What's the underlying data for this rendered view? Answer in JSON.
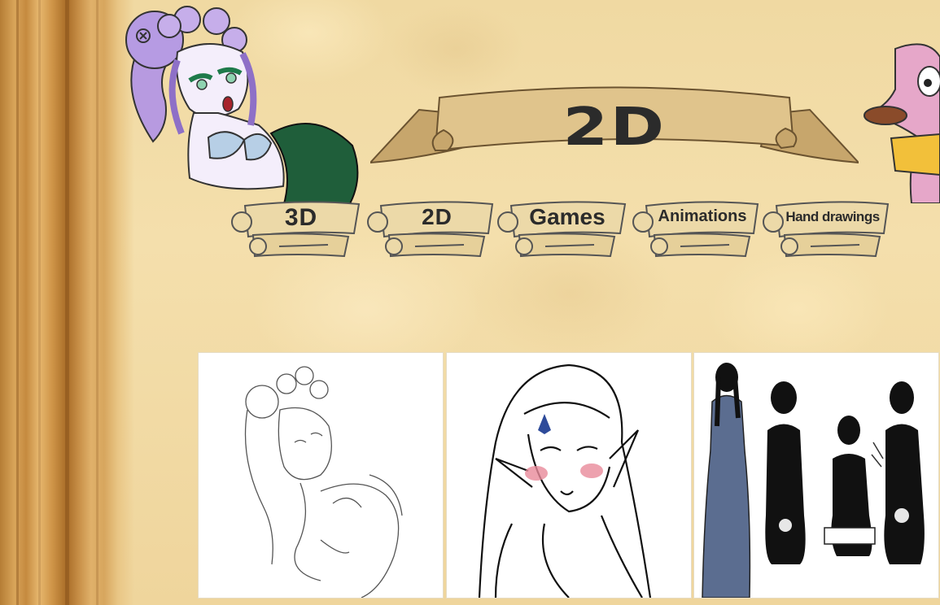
{
  "header": {
    "title": "2D"
  },
  "nav": {
    "items": [
      {
        "label": "3D"
      },
      {
        "label": "2D"
      },
      {
        "label": "Games"
      },
      {
        "label": "Animations"
      },
      {
        "label": "Hand drawings"
      }
    ]
  },
  "gallery": {
    "items": [
      {
        "name": "mermaid-sketch"
      },
      {
        "name": "elf-blushing"
      },
      {
        "name": "dark-haired-woman-poses"
      }
    ]
  },
  "colors": {
    "parchment": "#f2dca8",
    "scroll": "#dcc08a",
    "text": "#2b2b2b"
  }
}
